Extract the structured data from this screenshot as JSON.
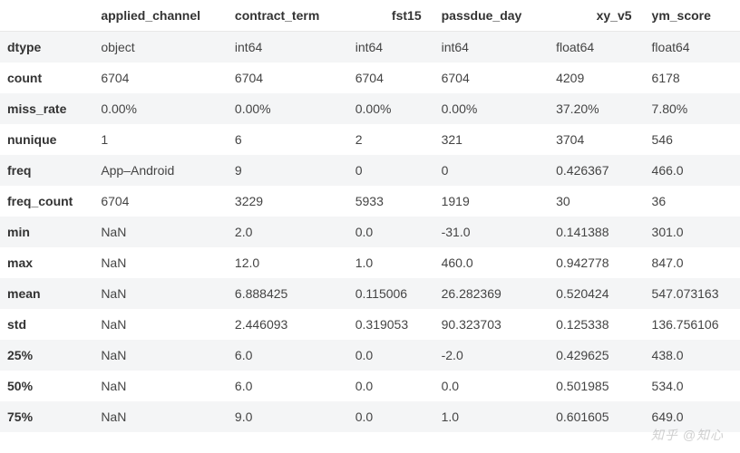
{
  "chart_data": {
    "type": "table",
    "title": "",
    "columns": [
      "applied_channel",
      "contract_term",
      "fst15",
      "passdue_day",
      "xy_v5",
      "ym_score"
    ],
    "index": [
      "dtype",
      "count",
      "miss_rate",
      "nunique",
      "freq",
      "freq_count",
      "min",
      "max",
      "mean",
      "std",
      "25%",
      "50%",
      "75%"
    ],
    "rows": {
      "dtype": [
        "object",
        "int64",
        "int64",
        "int64",
        "float64",
        "float64"
      ],
      "count": [
        "6704",
        "6704",
        "6704",
        "6704",
        "4209",
        "6178"
      ],
      "miss_rate": [
        "0.00%",
        "0.00%",
        "0.00%",
        "0.00%",
        "37.20%",
        "7.80%"
      ],
      "nunique": [
        "1",
        "6",
        "2",
        "321",
        "3704",
        "546"
      ],
      "freq": [
        "App–Android",
        "9",
        "0",
        "0",
        "0.426367",
        "466.0"
      ],
      "freq_count": [
        "6704",
        "3229",
        "5933",
        "1919",
        "30",
        "36"
      ],
      "min": [
        "NaN",
        "2.0",
        "0.0",
        "-31.0",
        "0.141388",
        "301.0"
      ],
      "max": [
        "NaN",
        "12.0",
        "1.0",
        "460.0",
        "0.942778",
        "847.0"
      ],
      "mean": [
        "NaN",
        "6.888425",
        "0.115006",
        "26.282369",
        "0.520424",
        "547.073163"
      ],
      "std": [
        "NaN",
        "2.446093",
        "0.319053",
        "90.323703",
        "0.125338",
        "136.756106"
      ],
      "25%": [
        "NaN",
        "6.0",
        "0.0",
        "-2.0",
        "0.429625",
        "438.0"
      ],
      "50%": [
        "NaN",
        "6.0",
        "0.0",
        "0.0",
        "0.501985",
        "534.0"
      ],
      "75%": [
        "NaN",
        "9.0",
        "0.0",
        "1.0",
        "0.601605",
        "649.0"
      ]
    }
  },
  "watermark": "知乎 @知心"
}
